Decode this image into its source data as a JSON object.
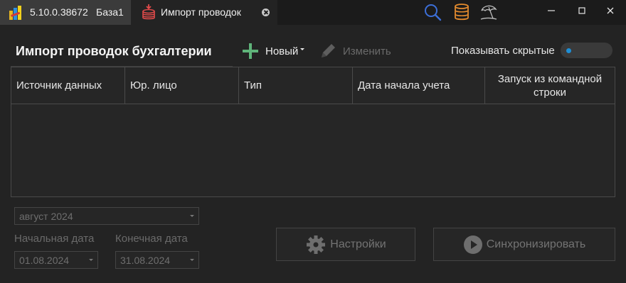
{
  "titlebar": {
    "app_version": "5.10.0.38672",
    "db_name": "База1",
    "tab_title": "Импорт проводок"
  },
  "header": {
    "title": "Импорт проводок бухгалтерии",
    "new_label": "Новый",
    "edit_label": "Изменить",
    "show_hidden_label": "Показывать скрытые"
  },
  "table": {
    "columns": [
      {
        "label": "Источник данных"
      },
      {
        "label": "Юр. лицо"
      },
      {
        "label": "Тип"
      },
      {
        "label": "Дата начала учета"
      },
      {
        "label": "Запуск из командной строки"
      }
    ],
    "rows": []
  },
  "filters": {
    "period_value": "август 2024",
    "start_label": "Начальная дата",
    "start_value": "01.08.2024",
    "end_label": "Конечная дата",
    "end_value": "31.08.2024"
  },
  "actions": {
    "settings_label": "Настройки",
    "sync_label": "Синхронизировать"
  },
  "colors": {
    "accent_blue": "#1e8fd6",
    "plus_green": "#5fb47a",
    "db_orange": "#e28a2e",
    "search_blue": "#3c6fd8",
    "import_red": "#e04a4a"
  },
  "icons": {
    "app": "app-logo-icon",
    "tab": "database-import-icon",
    "search": "search-icon",
    "database": "database-icon",
    "beach": "beach-umbrella-icon",
    "new": "plus-icon",
    "edit": "pencil-icon",
    "settings": "gear-icon",
    "sync": "play-circle-icon"
  }
}
